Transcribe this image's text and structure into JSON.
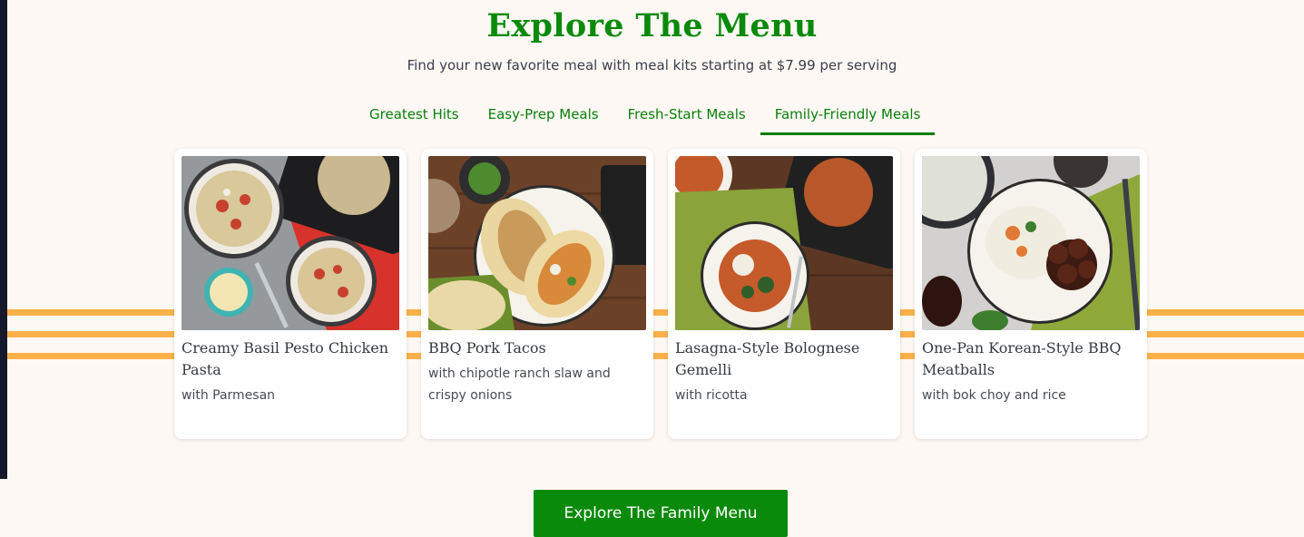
{
  "section": {
    "title": "Explore The Menu",
    "subtitle": "Find your new favorite meal with meal kits starting at $7.99 per serving"
  },
  "tabs": [
    {
      "label": "Greatest Hits",
      "active": false
    },
    {
      "label": "Easy-Prep Meals",
      "active": false
    },
    {
      "label": "Fresh-Start Meals",
      "active": false
    },
    {
      "label": "Family-Friendly Meals",
      "active": true
    }
  ],
  "cards": [
    {
      "title": "Creamy Basil Pesto Chicken Pasta",
      "subtitle": "with Parmesan"
    },
    {
      "title": "BBQ Pork Tacos",
      "subtitle": "with chipotle ranch slaw and crispy onions"
    },
    {
      "title": "Lasagna-Style Bolognese Gemelli",
      "subtitle": "with ricotta"
    },
    {
      "title": "One-Pan Korean-Style BBQ Meatballs",
      "subtitle": "with bok choy and rice"
    }
  ],
  "cta": {
    "label": "Explore The Family Menu"
  },
  "colors": {
    "brand_green": "#0a8a0a",
    "stripe_orange": "#fbb14a",
    "background": "#fdf8f4"
  }
}
